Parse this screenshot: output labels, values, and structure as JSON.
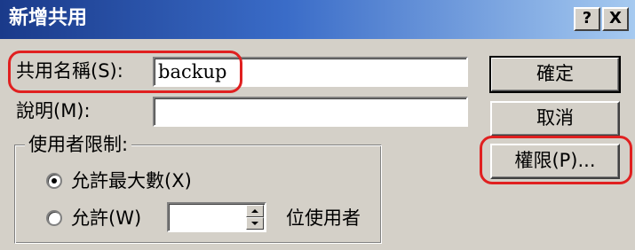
{
  "window": {
    "title": "新增共用",
    "help_button": "?",
    "close_button": "X"
  },
  "share_name": {
    "label": "共用名稱(S):",
    "value": "backup"
  },
  "description": {
    "label": "說明(M):",
    "value": ""
  },
  "buttons": {
    "ok": "確定",
    "cancel": "取消",
    "permissions": "權限(P)..."
  },
  "user_limit": {
    "group_label": "使用者限制:",
    "max_allowed_label": "允許最大數(X)",
    "max_allowed_selected": true,
    "allow_label": "允許(W)",
    "allow_selected": false,
    "allow_value": "",
    "allow_suffix": "位使用者"
  },
  "colors": {
    "highlight": "#e02020",
    "title_start": "#1a3a8a",
    "title_end": "#a6caf0",
    "dialog_bg": "#d4d0c8"
  }
}
